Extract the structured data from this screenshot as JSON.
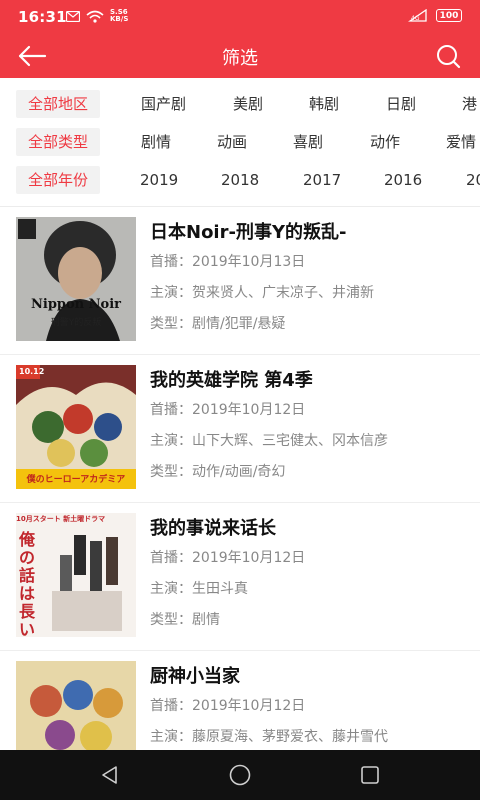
{
  "status": {
    "time": "16:31",
    "net_speed_top": "S.S6",
    "net_speed_bottom": "KB/S",
    "battery": "100"
  },
  "header": {
    "title": "筛选",
    "back_icon": "back-arrow-icon",
    "search_icon": "search-icon"
  },
  "filters": {
    "region": {
      "selected": "全部地区",
      "options": [
        "国产剧",
        "美剧",
        "韩剧",
        "日剧",
        "港"
      ]
    },
    "type": {
      "selected": "全部类型",
      "options": [
        "剧情",
        "动画",
        "喜剧",
        "动作",
        "爱情"
      ]
    },
    "year": {
      "selected": "全部年份",
      "options": [
        "2019",
        "2018",
        "2017",
        "2016",
        "20"
      ]
    }
  },
  "shows": [
    {
      "title": "日本Noir-刑事Y的叛乱-",
      "premiere": "首播：2019年10月13日",
      "cast": "主演：贺来贤人、广末凉子、井浦新",
      "genre": "类型：剧情/犯罪/悬疑",
      "poster_text": "Nippon Noir",
      "poster_sub": "刑警Y的反叛"
    },
    {
      "title": "我的英雄学院 第4季",
      "premiere": "首播：2019年10月12日",
      "cast": "主演：山下大辉、三宅健太、冈本信彦",
      "genre": "类型：动作/动画/奇幻",
      "poster_text": "僕のヒーローアカデミア",
      "poster_sub": "10.12"
    },
    {
      "title": "我的事说来话长",
      "premiere": "首播：2019年10月12日",
      "cast": "主演：生田斗真",
      "genre": "类型：剧情",
      "poster_text": "俺の話は長い",
      "poster_sub": "10月スタート 新土曜ドラマ"
    },
    {
      "title": "厨神小当家",
      "premiere": "首播：2019年10月12日",
      "cast": "主演：藤原夏海、茅野爱衣、藤井雪代",
      "genre": "",
      "poster_text": "",
      "poster_sub": ""
    }
  ],
  "colors": {
    "accent": "#ef3a43",
    "selected_bg": "#f2f2f2",
    "text_secondary": "#888888"
  },
  "navigation": {
    "back": "triangle-back-icon",
    "home": "circle-home-icon",
    "recents": "square-recents-icon"
  }
}
